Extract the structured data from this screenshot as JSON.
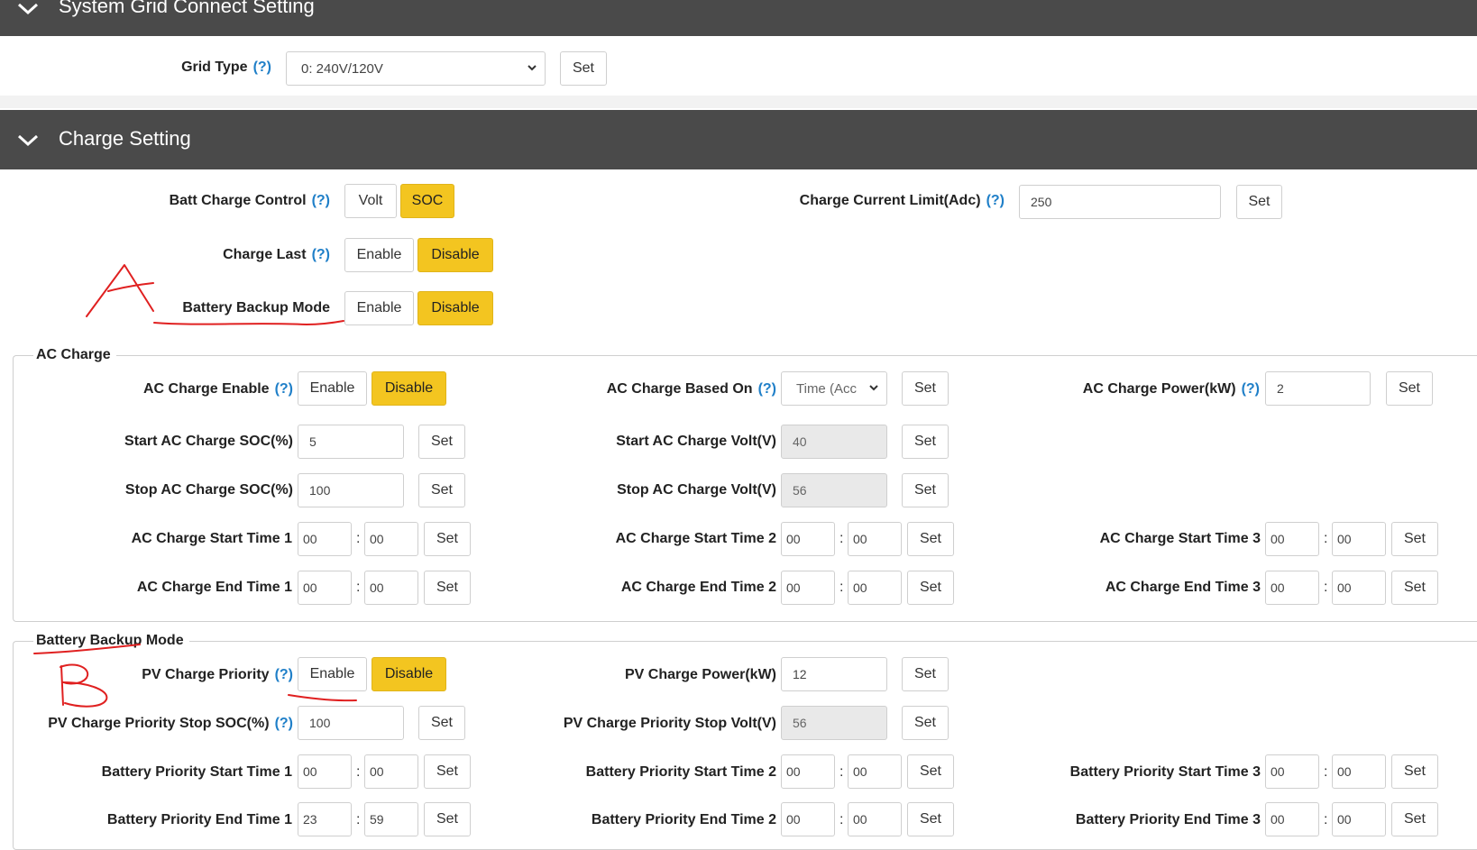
{
  "sections": {
    "grid": {
      "title": "System Grid Connect Setting"
    },
    "charge": {
      "title": "Charge Setting"
    }
  },
  "grid_type": {
    "label": "Grid Type",
    "help": "(?)",
    "value": "0: 240V/120V",
    "set": "Set"
  },
  "batt_charge_control": {
    "label": "Batt Charge Control",
    "help": "(?)",
    "opt1": "Volt",
    "opt2": "SOC",
    "selected": "SOC"
  },
  "charge_current_limit": {
    "label": "Charge Current Limit(Adc)",
    "help": "(?)",
    "value": "250",
    "set": "Set"
  },
  "charge_last": {
    "label": "Charge Last",
    "help": "(?)",
    "enable": "Enable",
    "disable": "Disable",
    "selected": "Disable"
  },
  "battery_backup_mode": {
    "label": "Battery Backup Mode",
    "enable": "Enable",
    "disable": "Disable",
    "selected": "Disable"
  },
  "ac_charge": {
    "legend": "AC Charge",
    "enable": {
      "label": "AC Charge Enable",
      "help": "(?)",
      "enable": "Enable",
      "disable": "Disable",
      "selected": "Disable"
    },
    "based_on": {
      "label": "AC Charge Based On",
      "help": "(?)",
      "value": "Time (Acc",
      "set": "Set"
    },
    "power": {
      "label": "AC Charge Power(kW)",
      "help": "(?)",
      "value": "2",
      "set": "Set"
    },
    "start_soc": {
      "label": "Start AC Charge SOC(%)",
      "value": "5",
      "set": "Set"
    },
    "start_volt": {
      "label": "Start AC Charge Volt(V)",
      "value": "40",
      "set": "Set"
    },
    "stop_soc": {
      "label": "Stop AC Charge SOC(%)",
      "value": "100",
      "set": "Set"
    },
    "stop_volt": {
      "label": "Stop AC Charge Volt(V)",
      "value": "56",
      "set": "Set"
    },
    "start_time_1": {
      "label": "AC Charge Start Time 1",
      "h": "00",
      "m": "00",
      "set": "Set"
    },
    "start_time_2": {
      "label": "AC Charge Start Time 2",
      "h": "00",
      "m": "00",
      "set": "Set"
    },
    "start_time_3": {
      "label": "AC Charge Start Time 3",
      "h": "00",
      "m": "00",
      "set": "Set"
    },
    "end_time_1": {
      "label": "AC Charge End Time 1",
      "h": "00",
      "m": "00",
      "set": "Set"
    },
    "end_time_2": {
      "label": "AC Charge End Time 2",
      "h": "00",
      "m": "00",
      "set": "Set"
    },
    "end_time_3": {
      "label": "AC Charge End Time 3",
      "h": "00",
      "m": "00",
      "set": "Set"
    }
  },
  "backup": {
    "legend": "Battery Backup Mode",
    "pv_priority": {
      "label": "PV Charge Priority",
      "help": "(?)",
      "enable": "Enable",
      "disable": "Disable",
      "selected": "Disable"
    },
    "pv_power": {
      "label": "PV Charge Power(kW)",
      "value": "12",
      "set": "Set"
    },
    "stop_soc": {
      "label": "PV Charge Priority Stop SOC(%)",
      "help": "(?)",
      "value": "100",
      "set": "Set"
    },
    "stop_volt": {
      "label": "PV Charge Priority Stop Volt(V)",
      "value": "56",
      "set": "Set"
    },
    "start_time_1": {
      "label": "Battery Priority Start Time 1",
      "h": "00",
      "m": "00",
      "set": "Set"
    },
    "start_time_2": {
      "label": "Battery Priority Start Time 2",
      "h": "00",
      "m": "00",
      "set": "Set"
    },
    "start_time_3": {
      "label": "Battery Priority Start Time 3",
      "h": "00",
      "m": "00",
      "set": "Set"
    },
    "end_time_1": {
      "label": "Battery Priority End Time 1",
      "h": "23",
      "m": "59",
      "set": "Set"
    },
    "end_time_2": {
      "label": "Battery Priority End Time 2",
      "h": "00",
      "m": "00",
      "set": "Set"
    },
    "end_time_3": {
      "label": "Battery Priority End Time 3",
      "h": "00",
      "m": "00",
      "set": "Set"
    }
  },
  "colon": ":",
  "colors": {
    "header_bg": "#4a4a4a",
    "selected_button": "#f3c520",
    "help_link": "#1f7fc8",
    "annotation": "#e02020"
  },
  "icons": {
    "section_toggle": "chevron-down-icon",
    "select_arrow": "chevron-down-icon"
  }
}
